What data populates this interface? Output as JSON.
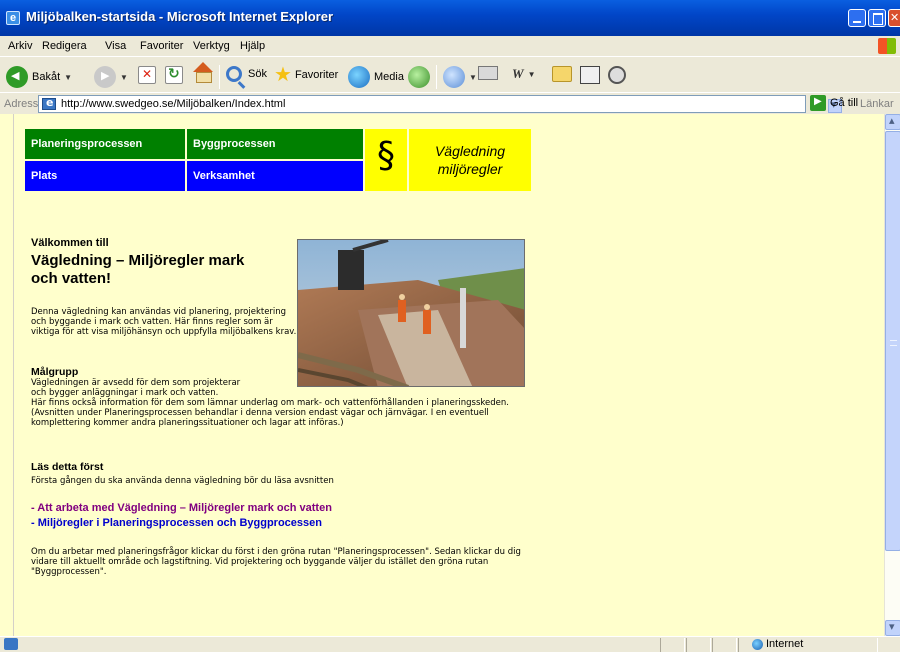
{
  "window": {
    "title": "Miljöbalken-startsida - Microsoft Internet Explorer"
  },
  "menu": [
    "Arkiv",
    "Redigera",
    "Visa",
    "Favoriter",
    "Verktyg",
    "Hjälp"
  ],
  "toolbar": {
    "back_label": "Bakåt",
    "search_label": "Sök",
    "favorites_label": "Favoriter",
    "media_label": "Media"
  },
  "address": {
    "label": "Adress",
    "url": "http://www.swedgeo.se/Miljöbalken/Index.html",
    "go_label": "Gå till",
    "links_label": "Länkar"
  },
  "nav": {
    "planering": "Planeringsprocessen",
    "bygg": "Byggprocessen",
    "plats": "Plats",
    "verksamhet": "Verksamhet",
    "paragraph_symbol": "§",
    "title_line1": "Vägledning",
    "title_line2": "miljöregler"
  },
  "content": {
    "welcome_small": "Välkommen till",
    "welcome_big": "Vägledning – Miljöregler mark och vatten!",
    "intro": "Denna vägledning kan användas vid planering, projektering och byggande i mark och vatten. Här finns regler som är viktiga för att visa miljöhänsyn och uppfylla miljöbalkens krav.",
    "target_heading": "Målgrupp",
    "target_text1": "Vägledningen är avsedd för dem som projekterar",
    "target_text2": "och bygger anläggningar i mark och vatten.",
    "target_text3": "Här finns också information för dem som lämnar underlag om mark- och vattenförhållanden i planeringsskeden. (Avsnitten under Planeringsprocessen behandlar i denna version endast vägar och järnvägar. I en eventuell komplettering kommer andra planeringssituationer och lagar att införas.)",
    "read_first_heading": "Läs detta först",
    "read_first_text": "Första gången du ska använda denna vägledning bör du läsa avsnitten",
    "link1": "- Att arbeta med Vägledning – Miljöregler mark och vatten",
    "link2": "- Miljöregler i Planeringsprocessen och Byggprocessen",
    "usage_text": "Om du arbetar med planeringsfrågor klickar du först i den gröna rutan \"Planeringsprocessen\". Sedan klickar du dig vidare till aktuellt område och lagstiftning. Vid projektering och byggande väljer du istället den gröna rutan \"Byggprocessen\"."
  },
  "status": {
    "zone": "Internet"
  },
  "colors": {
    "page_bg": "#ffffcc",
    "nav_green": "#008000",
    "nav_blue": "#0000ff",
    "nav_yellow": "#ffff00",
    "visited_link": "#800080",
    "link": "#0000cc"
  }
}
